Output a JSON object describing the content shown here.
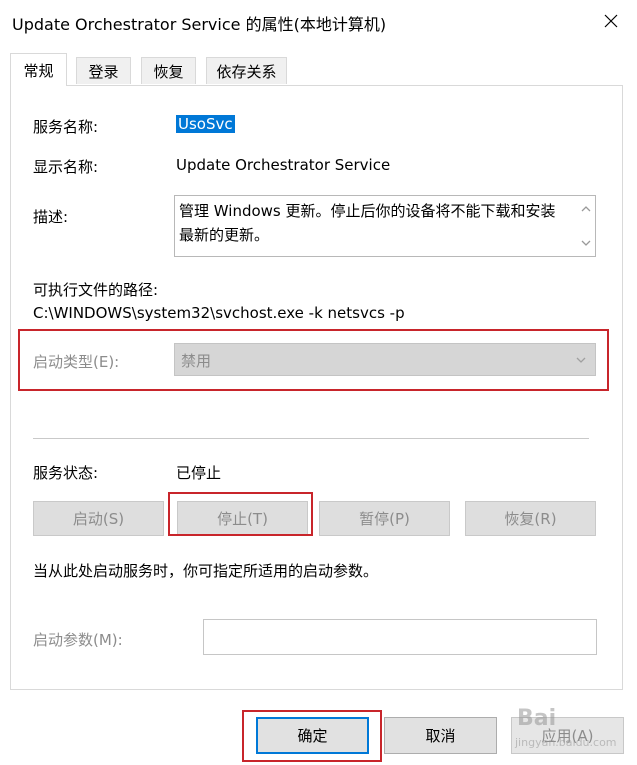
{
  "window": {
    "title": "Update Orchestrator Service 的属性(本地计算机)"
  },
  "tabs": [
    {
      "label": "常规",
      "active": true
    },
    {
      "label": "登录",
      "active": false
    },
    {
      "label": "恢复",
      "active": false
    },
    {
      "label": "依存关系",
      "active": false
    }
  ],
  "general": {
    "service_name_label": "服务名称:",
    "service_name_value": "UsoSvc",
    "display_name_label": "显示名称:",
    "display_name_value": "Update Orchestrator Service",
    "description_label": "描述:",
    "description_value": "管理 Windows 更新。停止后你的设备将不能下载和安装最新的更新。",
    "path_label": "可执行文件的路径:",
    "path_value": "C:\\WINDOWS\\system32\\svchost.exe -k netsvcs -p",
    "startup_type_label": "启动类型(E):",
    "startup_type_value": "禁用",
    "status_label": "服务状态:",
    "status_value": "已停止",
    "buttons": {
      "start": "启动(S)",
      "stop": "停止(T)",
      "pause": "暂停(P)",
      "resume": "恢复(R)"
    },
    "hint": "当从此处启动服务时，你可指定所适用的启动参数。",
    "start_params_label": "启动参数(M):",
    "start_params_value": ""
  },
  "footer": {
    "ok": "确定",
    "cancel": "取消",
    "apply": "应用(A)"
  },
  "watermark": {
    "text": "Bai",
    "sub": "jingyan.baidu.com"
  },
  "colors": {
    "highlight": "#c8252b",
    "selection": "#0078d7",
    "disabled_text": "#8c8c8c"
  }
}
